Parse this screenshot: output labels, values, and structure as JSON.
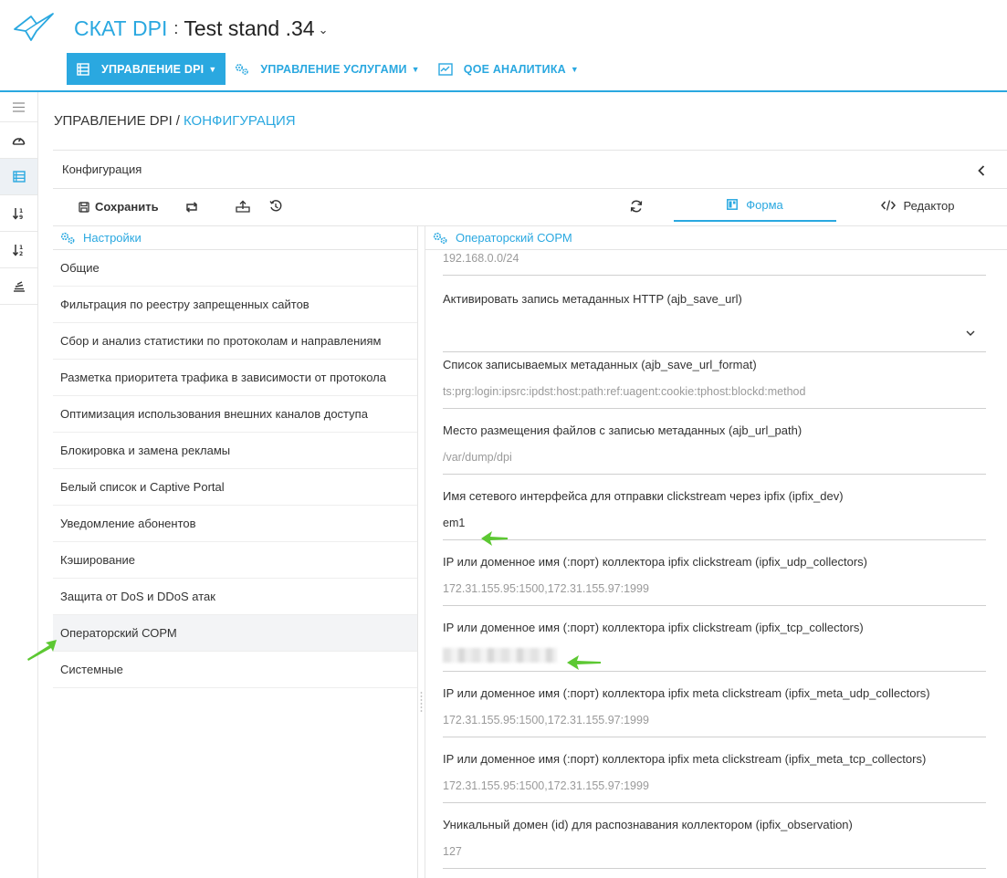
{
  "header": {
    "app_name": "СКАТ DPI",
    "separator": ":",
    "stand_name": "Test stand .34",
    "stand_caret": "⌄"
  },
  "nav": [
    {
      "label": "УПРАВЛЕНИЕ DPI",
      "icon": "server-icon",
      "active": true
    },
    {
      "label": "УПРАВЛЕНИЕ УСЛУГАМИ",
      "icon": "gears-icon",
      "active": false
    },
    {
      "label": "QOE АНАЛИТИКА",
      "icon": "chart-icon",
      "active": false
    }
  ],
  "sidebar": [
    {
      "icon": "hamburger-icon"
    },
    {
      "icon": "dashboard-icon"
    },
    {
      "icon": "server-icon",
      "active": true
    },
    {
      "icon": "sort-desc-icon"
    },
    {
      "icon": "sort-numeric-icon"
    },
    {
      "icon": "stack-icon"
    }
  ],
  "breadcrumb": {
    "part1": "УПРАВЛЕНИЕ DPI",
    "separator": "/",
    "part2": "КОНФИГУРАЦИЯ"
  },
  "card": {
    "title": "Конфигурация"
  },
  "toolbar": {
    "save_label": "Сохранить",
    "tab_form": "Форма",
    "tab_editor": "Редактор"
  },
  "left_panel": {
    "title": "Настройки",
    "items": [
      "Общие",
      "Фильтрация по реестру запрещенных сайтов",
      "Сбор и анализ статистики по протоколам и направлениям",
      "Разметка приоритета трафика в зависимости от протокола",
      "Оптимизация использования внешних каналов доступа",
      "Блокировка и замена рекламы",
      "Белый список и Captive Portal",
      "Уведомление абонентов",
      "Кэширование",
      "Защита от DoS и DDoS атак",
      "Операторский СОРМ",
      "Системные"
    ],
    "active_index": 10
  },
  "right_panel": {
    "title": "Операторский СОРМ",
    "fields": [
      {
        "label": "",
        "value": "192.168.0.0/24"
      },
      {
        "label": "Активировать запись метаданных HTTP (ajb_save_url)",
        "value": ""
      },
      {
        "label": "Список записываемых метаданных (ajb_save_url_format)",
        "value": "ts:prg:login:ipsrc:ipdst:host:path:ref:uagent:cookie:tphost:blockd:method"
      },
      {
        "label": "Место размещения файлов с записью метаданных (ajb_url_path)",
        "value": "/var/dump/dpi"
      },
      {
        "label": "Имя сетевого интерфейса для отправки clickstream через ipfix (ipfix_dev)",
        "value": "em1"
      },
      {
        "label": "IP или доменное имя (:порт) коллектора ipfix clickstream (ipfix_udp_collectors)",
        "value": "172.31.155.95:1500,172.31.155.97:1999"
      },
      {
        "label": "IP или доменное имя (:порт) коллектора ipfix clickstream (ipfix_tcp_collectors)",
        "value": ""
      },
      {
        "label": "IP или доменное имя (:порт) коллектора ipfix meta clickstream (ipfix_meta_udp_collectors)",
        "value": "172.31.155.95:1500,172.31.155.97:1999"
      },
      {
        "label": "IP или доменное имя (:порт) коллектора ipfix meta clickstream (ipfix_meta_tcp_collectors)",
        "value": "172.31.155.95:1500,172.31.155.97:1999"
      },
      {
        "label": "Уникальный домен (id) для распознавания коллектором (ipfix_observation)",
        "value": "127"
      }
    ]
  },
  "colors": {
    "accent": "#2aa8e0",
    "annotation_arrow": "#5cc832"
  }
}
